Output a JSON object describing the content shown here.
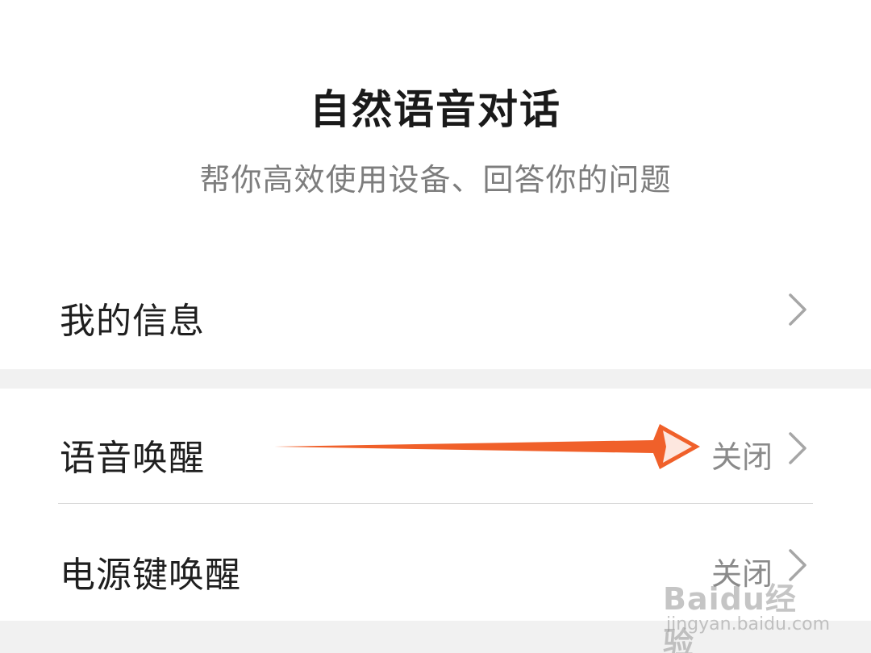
{
  "header": {
    "title": "自然语音对话",
    "subtitle": "帮你高效使用设备、回答你的问题"
  },
  "settings": {
    "items": [
      {
        "label": "我的信息",
        "status": ""
      },
      {
        "label": "语音唤醒",
        "status": "关闭"
      },
      {
        "label": "电源键唤醒",
        "status": "关闭"
      }
    ]
  },
  "annotation": {
    "arrow_color": "#f0602a"
  },
  "watermark": {
    "logo": "Baidu经验",
    "url": "jingyan.baidu.com"
  },
  "icons": {
    "chevron": "chevron-right-icon"
  }
}
